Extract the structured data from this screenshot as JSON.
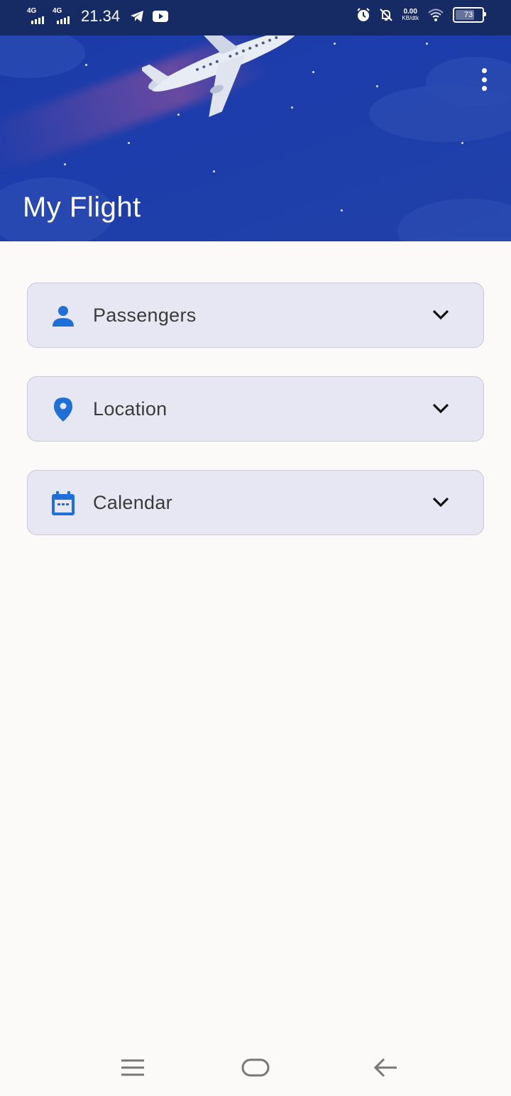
{
  "status_bar": {
    "network_1": "4G",
    "network_2": "4G",
    "time": "21.34",
    "data_speed_value": "0.00",
    "data_speed_unit": "KB/dtk",
    "battery_level": "73",
    "battery_fraction": 0.73
  },
  "header": {
    "title": "My Flight",
    "more_icon": "more-vertical-icon"
  },
  "filters": [
    {
      "label": "Passengers",
      "icon": "person-icon",
      "accent": "#1e6fd8"
    },
    {
      "label": "Location",
      "icon": "location-pin-icon",
      "accent": "#1e6fd8"
    },
    {
      "label": "Calendar",
      "icon": "calendar-icon",
      "accent": "#1e6fd8"
    }
  ],
  "nav_bar": {
    "items": [
      "menu-icon",
      "home-icon",
      "back-icon"
    ]
  },
  "colors": {
    "header_bg": "#1c3aa8",
    "card_bg": "#e7e7f3",
    "card_border": "#c9c7d8",
    "page_bg": "#fbfaf8"
  }
}
